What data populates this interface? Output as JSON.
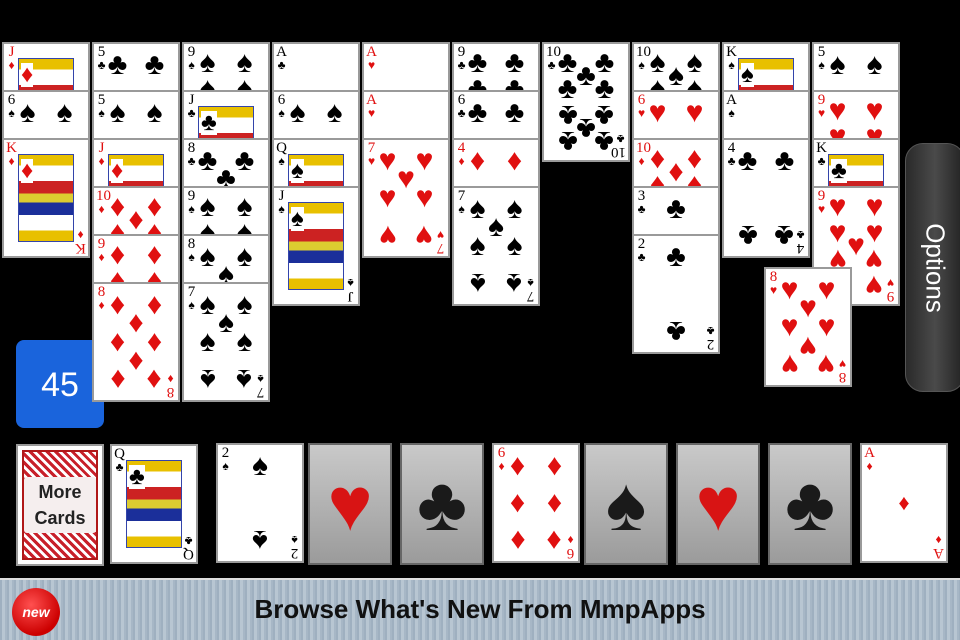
{
  "score": "45",
  "options_label": "Options",
  "deck_label": "More Cards",
  "banner": {
    "text": "Browse What's New From MmpApps",
    "badge": "new"
  },
  "colors": {
    "score_bg": "#1a64dc",
    "red_suit": "#e01010"
  },
  "tableau": [
    [
      {
        "rank": "J",
        "suit": "diamonds"
      },
      {
        "rank": "6",
        "suit": "spades"
      },
      {
        "rank": "K",
        "suit": "diamonds"
      }
    ],
    [
      {
        "rank": "5",
        "suit": "clubs"
      },
      {
        "rank": "5",
        "suit": "spades"
      },
      {
        "rank": "J",
        "suit": "diamonds"
      },
      {
        "rank": "10",
        "suit": "diamonds"
      },
      {
        "rank": "9",
        "suit": "diamonds"
      },
      {
        "rank": "8",
        "suit": "diamonds"
      }
    ],
    [
      {
        "rank": "9",
        "suit": "spades"
      },
      {
        "rank": "J",
        "suit": "clubs"
      },
      {
        "rank": "8",
        "suit": "clubs"
      },
      {
        "rank": "9",
        "suit": "spades"
      },
      {
        "rank": "8",
        "suit": "spades"
      },
      {
        "rank": "7",
        "suit": "spades"
      }
    ],
    [
      {
        "rank": "A",
        "suit": "clubs"
      },
      {
        "rank": "6",
        "suit": "spades"
      },
      {
        "rank": "Q",
        "suit": "spades"
      },
      {
        "rank": "J",
        "suit": "spades"
      }
    ],
    [
      {
        "rank": "A",
        "suit": "hearts"
      },
      {
        "rank": "A",
        "suit": "hearts"
      },
      {
        "rank": "7",
        "suit": "hearts"
      }
    ],
    [
      {
        "rank": "9",
        "suit": "clubs"
      },
      {
        "rank": "6",
        "suit": "clubs"
      },
      {
        "rank": "4",
        "suit": "diamonds"
      },
      {
        "rank": "7",
        "suit": "spades"
      }
    ],
    [
      {
        "rank": "10",
        "suit": "clubs"
      }
    ],
    [
      {
        "rank": "10",
        "suit": "spades"
      },
      {
        "rank": "6",
        "suit": "hearts"
      },
      {
        "rank": "10",
        "suit": "diamonds"
      },
      {
        "rank": "3",
        "suit": "clubs"
      },
      {
        "rank": "2",
        "suit": "clubs"
      }
    ],
    [
      {
        "rank": "K",
        "suit": "spades"
      },
      {
        "rank": "A",
        "suit": "spades"
      },
      {
        "rank": "4",
        "suit": "clubs"
      }
    ],
    [
      {
        "rank": "5",
        "suit": "spades"
      },
      {
        "rank": "9",
        "suit": "hearts"
      },
      {
        "rank": "K",
        "suit": "clubs"
      },
      {
        "rank": "9",
        "suit": "hearts"
      }
    ]
  ],
  "dragged_card": {
    "rank": "8",
    "suit": "hearts"
  },
  "waste_card": {
    "rank": "Q",
    "suit": "clubs"
  },
  "bottom_slots": [
    {
      "card": {
        "rank": "2",
        "suit": "spades"
      }
    },
    {
      "empty_suit": "hearts"
    },
    {
      "empty_suit": "clubs"
    },
    {
      "card": {
        "rank": "6",
        "suit": "diamonds"
      }
    },
    {
      "empty_suit": "spades"
    },
    {
      "empty_suit": "hearts"
    },
    {
      "empty_suit": "clubs"
    },
    {
      "card": {
        "rank": "A",
        "suit": "diamonds"
      }
    }
  ]
}
